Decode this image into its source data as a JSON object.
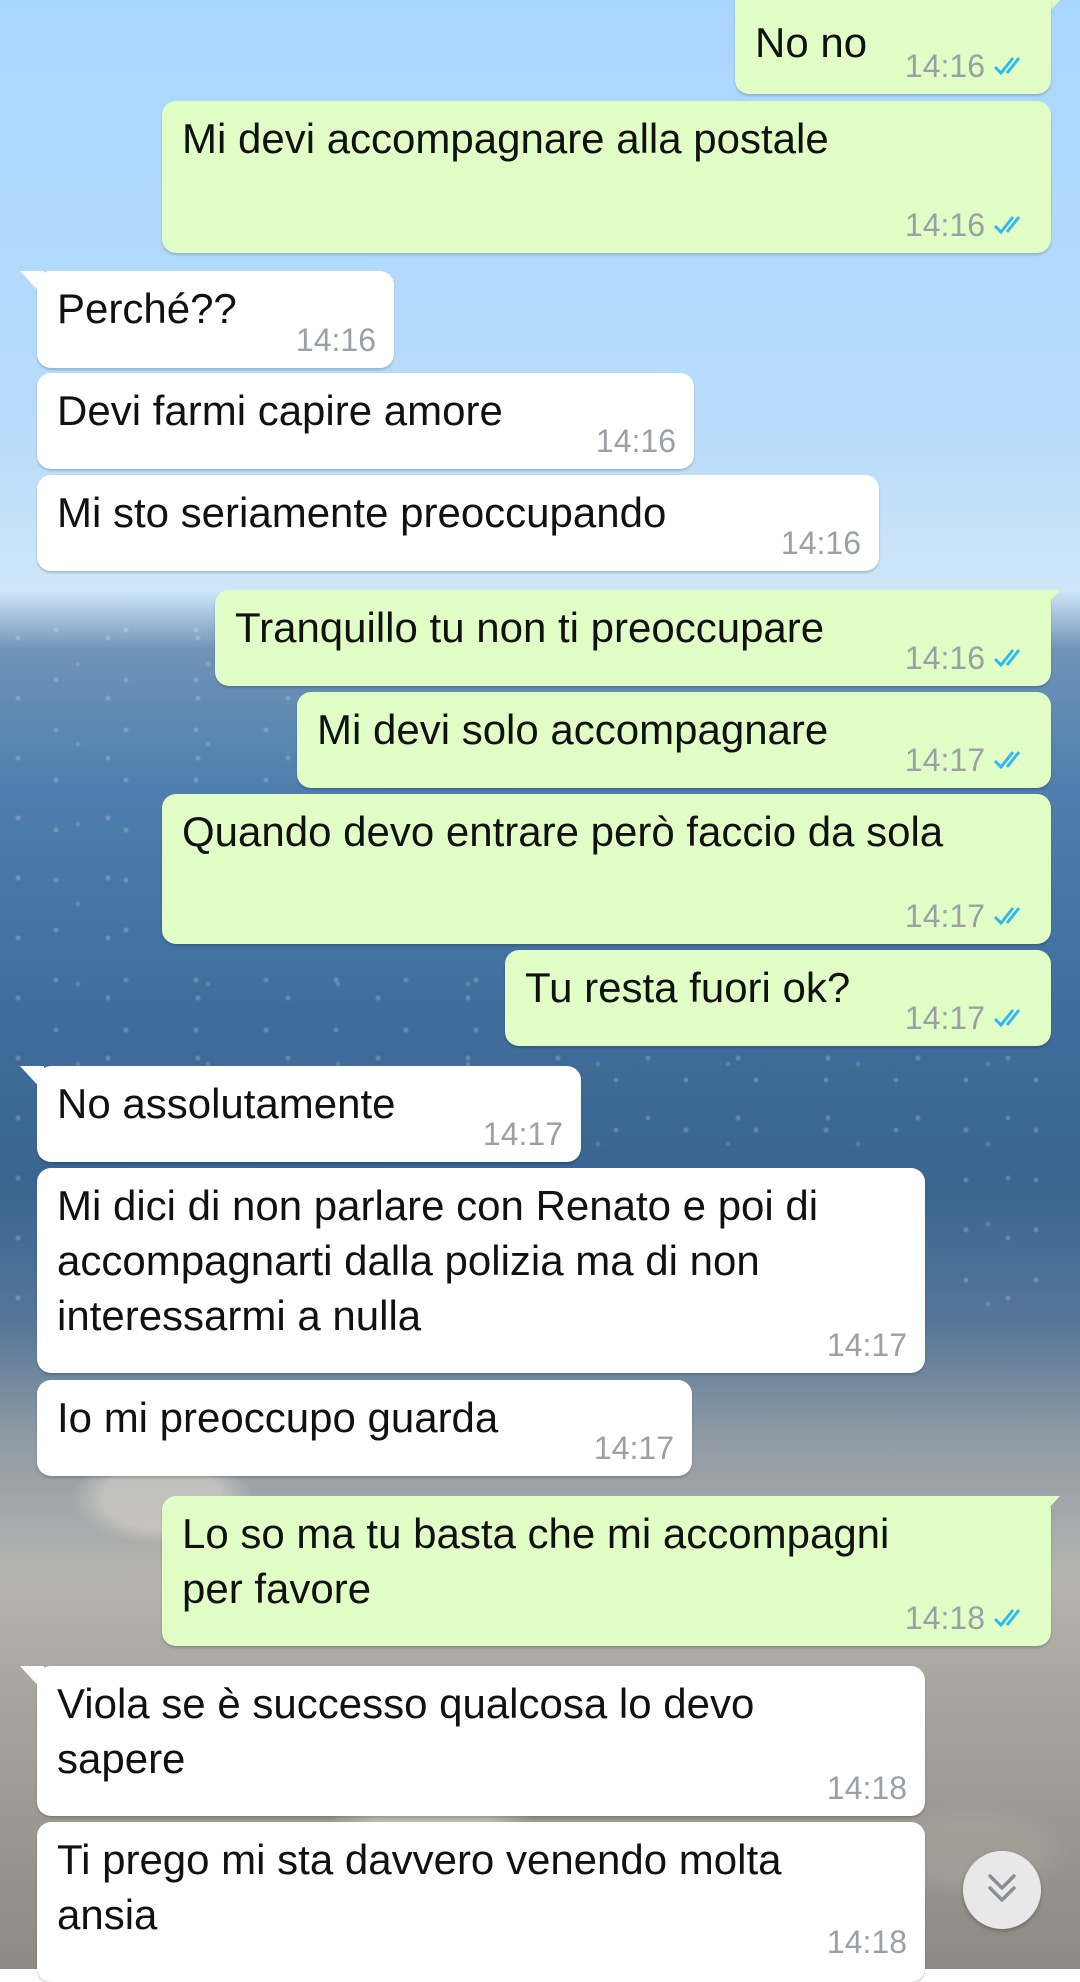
{
  "chat": {
    "colors": {
      "outgoing_bubble": "#e1fec6",
      "incoming_bubble": "#ffffff",
      "read_ticks": "#34b7f1",
      "timestamp": "#9aa0a6"
    },
    "messages": [
      {
        "dir": "out",
        "text": "No no",
        "time": "14:16",
        "status": "read"
      },
      {
        "dir": "out",
        "text": "Mi devi accompagnare alla postale",
        "time": "14:16",
        "status": "read"
      },
      {
        "dir": "in",
        "text": "Perché??",
        "time": "14:16"
      },
      {
        "dir": "in",
        "text": "Devi farmi capire amore",
        "time": "14:16"
      },
      {
        "dir": "in",
        "text": "Mi sto seriamente preoccupando",
        "time": "14:16"
      },
      {
        "dir": "out",
        "text": "Tranquillo tu non ti preoccupare",
        "time": "14:16",
        "status": "read"
      },
      {
        "dir": "out",
        "text": "Mi devi solo accompagnare",
        "time": "14:17",
        "status": "read"
      },
      {
        "dir": "out",
        "text": "Quando devo entrare però faccio da sola",
        "time": "14:17",
        "status": "read"
      },
      {
        "dir": "out",
        "text": "Tu resta fuori ok?",
        "time": "14:17",
        "status": "read"
      },
      {
        "dir": "in",
        "text": "No assolutamente",
        "time": "14:17"
      },
      {
        "dir": "in",
        "text": "Mi dici di non parlare con Renato e poi di\naccompagnarti dalla polizia ma di non\ninteressarmi a nulla",
        "time": "14:17"
      },
      {
        "dir": "in",
        "text": "Io mi preoccupo guarda",
        "time": "14:17"
      },
      {
        "dir": "out",
        "text": "Lo so ma tu basta che mi accompagni\nper favore",
        "time": "14:18",
        "status": "read"
      },
      {
        "dir": "in",
        "text": "Viola se è successo qualcosa lo devo\nsapere",
        "time": "14:18"
      },
      {
        "dir": "in",
        "text": "Ti prego mi sta davvero venendo molta\nansia",
        "time": "14:18"
      }
    ],
    "scroll_button_icon": "double-chevron-down-icon"
  }
}
